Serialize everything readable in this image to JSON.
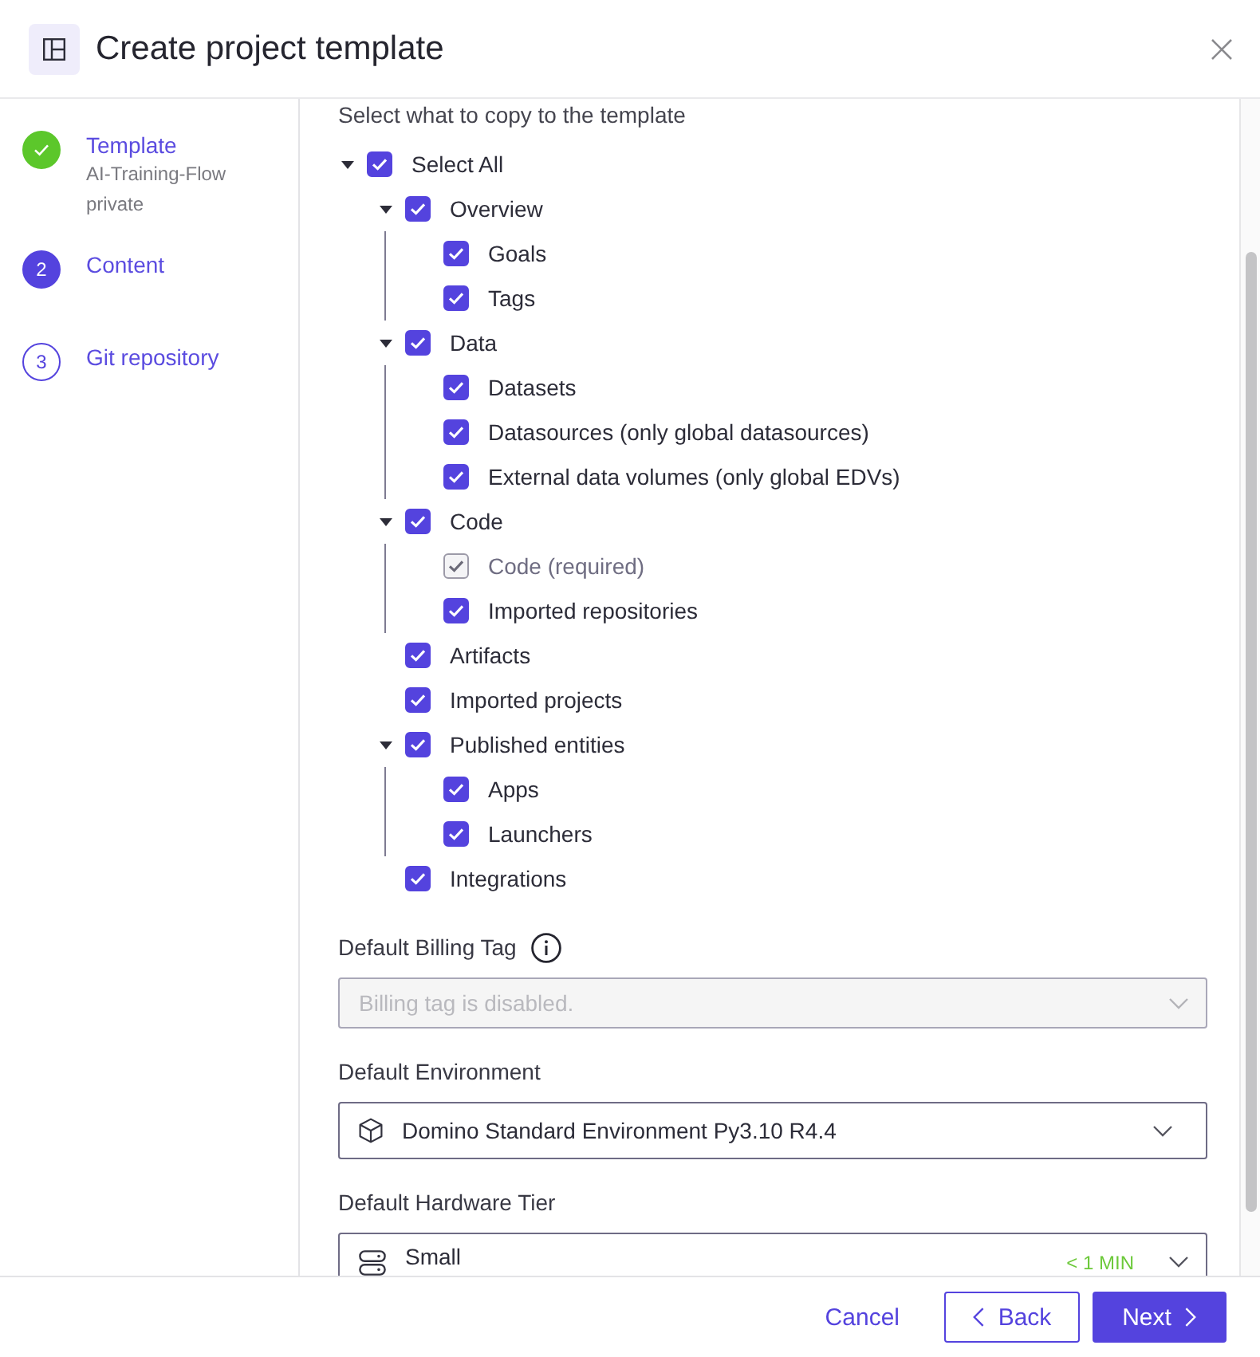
{
  "dialog": {
    "title": "Create project template"
  },
  "steps": [
    {
      "label": "Template",
      "completed": true,
      "selected": false,
      "details": [
        "AI-Training-Flow",
        "private"
      ]
    },
    {
      "number": "2",
      "label": "Content",
      "completed": false,
      "selected": true
    },
    {
      "number": "3",
      "label": "Git repository",
      "completed": false,
      "selected": false
    }
  ],
  "content": {
    "heading": "Select what to copy to the template",
    "tree": [
      {
        "label": "Select All",
        "checked": true,
        "disabled": false,
        "expanded": true,
        "children": [
          {
            "label": "Overview",
            "checked": true,
            "disabled": false,
            "expanded": true,
            "children": [
              {
                "label": "Goals",
                "checked": true,
                "disabled": false
              },
              {
                "label": "Tags",
                "checked": true,
                "disabled": false
              }
            ]
          },
          {
            "label": "Data",
            "checked": true,
            "disabled": false,
            "expanded": true,
            "children": [
              {
                "label": "Datasets",
                "checked": true,
                "disabled": false
              },
              {
                "label": "Datasources (only global datasources)",
                "checked": true,
                "disabled": false
              },
              {
                "label": "External data volumes (only global EDVs)",
                "checked": true,
                "disabled": false
              }
            ]
          },
          {
            "label": "Code",
            "checked": true,
            "disabled": false,
            "expanded": true,
            "children": [
              {
                "label": "Code (required)",
                "checked": true,
                "disabled": true
              },
              {
                "label": "Imported repositories",
                "checked": true,
                "disabled": false
              }
            ]
          },
          {
            "label": "Artifacts",
            "checked": true,
            "disabled": false
          },
          {
            "label": "Imported projects",
            "checked": true,
            "disabled": false
          },
          {
            "label": "Published entities",
            "checked": true,
            "disabled": false,
            "expanded": true,
            "children": [
              {
                "label": "Apps",
                "checked": true,
                "disabled": false
              },
              {
                "label": "Launchers",
                "checked": true,
                "disabled": false
              }
            ]
          },
          {
            "label": "Integrations",
            "checked": true,
            "disabled": false
          }
        ]
      }
    ]
  },
  "fields": [
    {
      "kind": "billing_tag",
      "label": "Default Billing Tag",
      "info": true,
      "placeholder": "Billing tag is disabled.",
      "disabled": true
    },
    {
      "kind": "environment",
      "label": "Default Environment",
      "value": "Domino Standard Environment Py3.10 R4.4",
      "disabled": false
    },
    {
      "kind": "hardware_tier",
      "label": "Default Hardware Tier",
      "value": "Small",
      "badge": "< 1 MIN",
      "disabled": false
    }
  ],
  "footer": {
    "buttons": [
      {
        "kind": "link",
        "label": "Cancel"
      },
      {
        "kind": "secondary",
        "label": "Back"
      },
      {
        "kind": "primary",
        "label": "Next"
      }
    ]
  }
}
